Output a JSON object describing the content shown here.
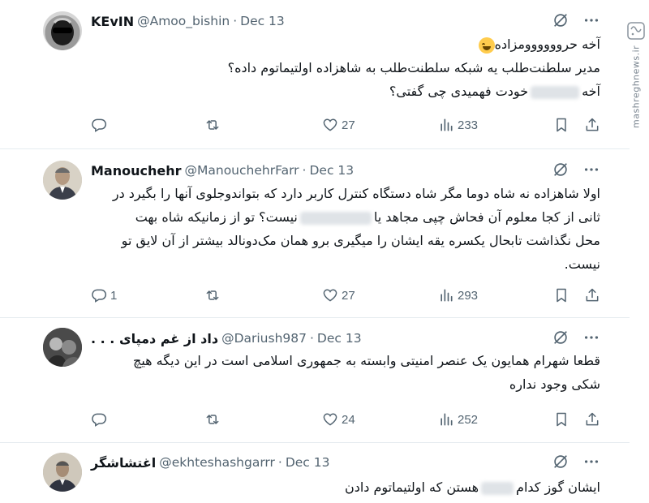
{
  "site": {
    "watermark_text": "mashreghnews.ir",
    "watermark_logo_text": "مشرق"
  },
  "tweets": [
    {
      "name": "KEvIN",
      "handle": "@Amoo_bishin",
      "separator": "·",
      "date": "Dec 13",
      "lines": [
        "آخه حروووووومزاده",
        "مدیر سلطنت‌طلب یه شبکه سلطنت‌طلب به شاهزاده اولتیماتوم داده؟"
      ],
      "line3_before": "آخه",
      "line3_after": "خودت فهمیدی چی گفتی؟",
      "reply_count": "",
      "likes": "27",
      "views": "233"
    },
    {
      "name": "Manouchehr",
      "handle": "@ManouchehrFarr",
      "separator": "·",
      "date": "Dec 13",
      "line1": "اولا شاهزاده نه شاه دوما مگر شاه دستگاه کنترل کاربر دارد که بتواندوجلوی آنها را بگیرد در",
      "line2_before": "ثانی از کجا معلوم آن فحاش چپی مجاهد یا",
      "line2_after": "نیست؟ تو از زمانیکه شاه بهت",
      "line3": "محل نگذاشت تابحال یکسره یقه ایشان را میگیری برو همان مک‌دونالد بیشتر از آن لایق تو",
      "line4": "نیست.",
      "reply_count": "1",
      "likes": "27",
      "views": "293"
    },
    {
      "name": "داد از غم دمپای . . .",
      "handle": "@Dariush987",
      "separator": "·",
      "date": "Dec 13",
      "lines": [
        "قطعا شهرام همایون یک عنصر امنیتی وابسته به جمهوری اسلامی است در این دیگه هیچ",
        "شکی وجود نداره"
      ],
      "reply_count": "",
      "likes": "24",
      "views": "252"
    },
    {
      "name": "اغتشاشگر",
      "handle": "@ekhteshashgarrr",
      "separator": "·",
      "date": "Dec 13",
      "line1_before": "ایشان گوز کدام",
      "line1_after": "هستن که اولتیماتوم دادن"
    }
  ],
  "icons": {
    "grok": "grok-icon",
    "more": "more-icon",
    "reply": "reply-icon",
    "repost": "repost-icon",
    "like": "like-icon",
    "views": "views-icon",
    "bookmark": "bookmark-icon",
    "share": "share-icon"
  },
  "colors": {
    "text": "#0f1419",
    "secondary": "#536471",
    "divider": "#e6ecf0"
  }
}
